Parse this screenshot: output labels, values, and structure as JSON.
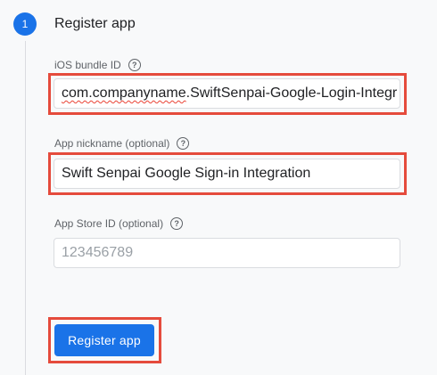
{
  "step": {
    "number": "1",
    "title": "Register app"
  },
  "fields": {
    "bundle_id": {
      "label": "iOS bundle ID",
      "value_prefix": "com.companyname",
      "value_suffix": ".SwiftSenpai-Google-Login-Integr"
    },
    "nickname": {
      "label": "App nickname (optional)",
      "value": "Swift Senpai Google Sign-in Integration"
    },
    "app_store_id": {
      "label": "App Store ID (optional)",
      "placeholder": "123456789"
    }
  },
  "register_button": {
    "label": "Register app"
  },
  "icons": {
    "help": "?"
  },
  "colors": {
    "accent": "#1a73e8",
    "highlight": "#e54b3c"
  }
}
